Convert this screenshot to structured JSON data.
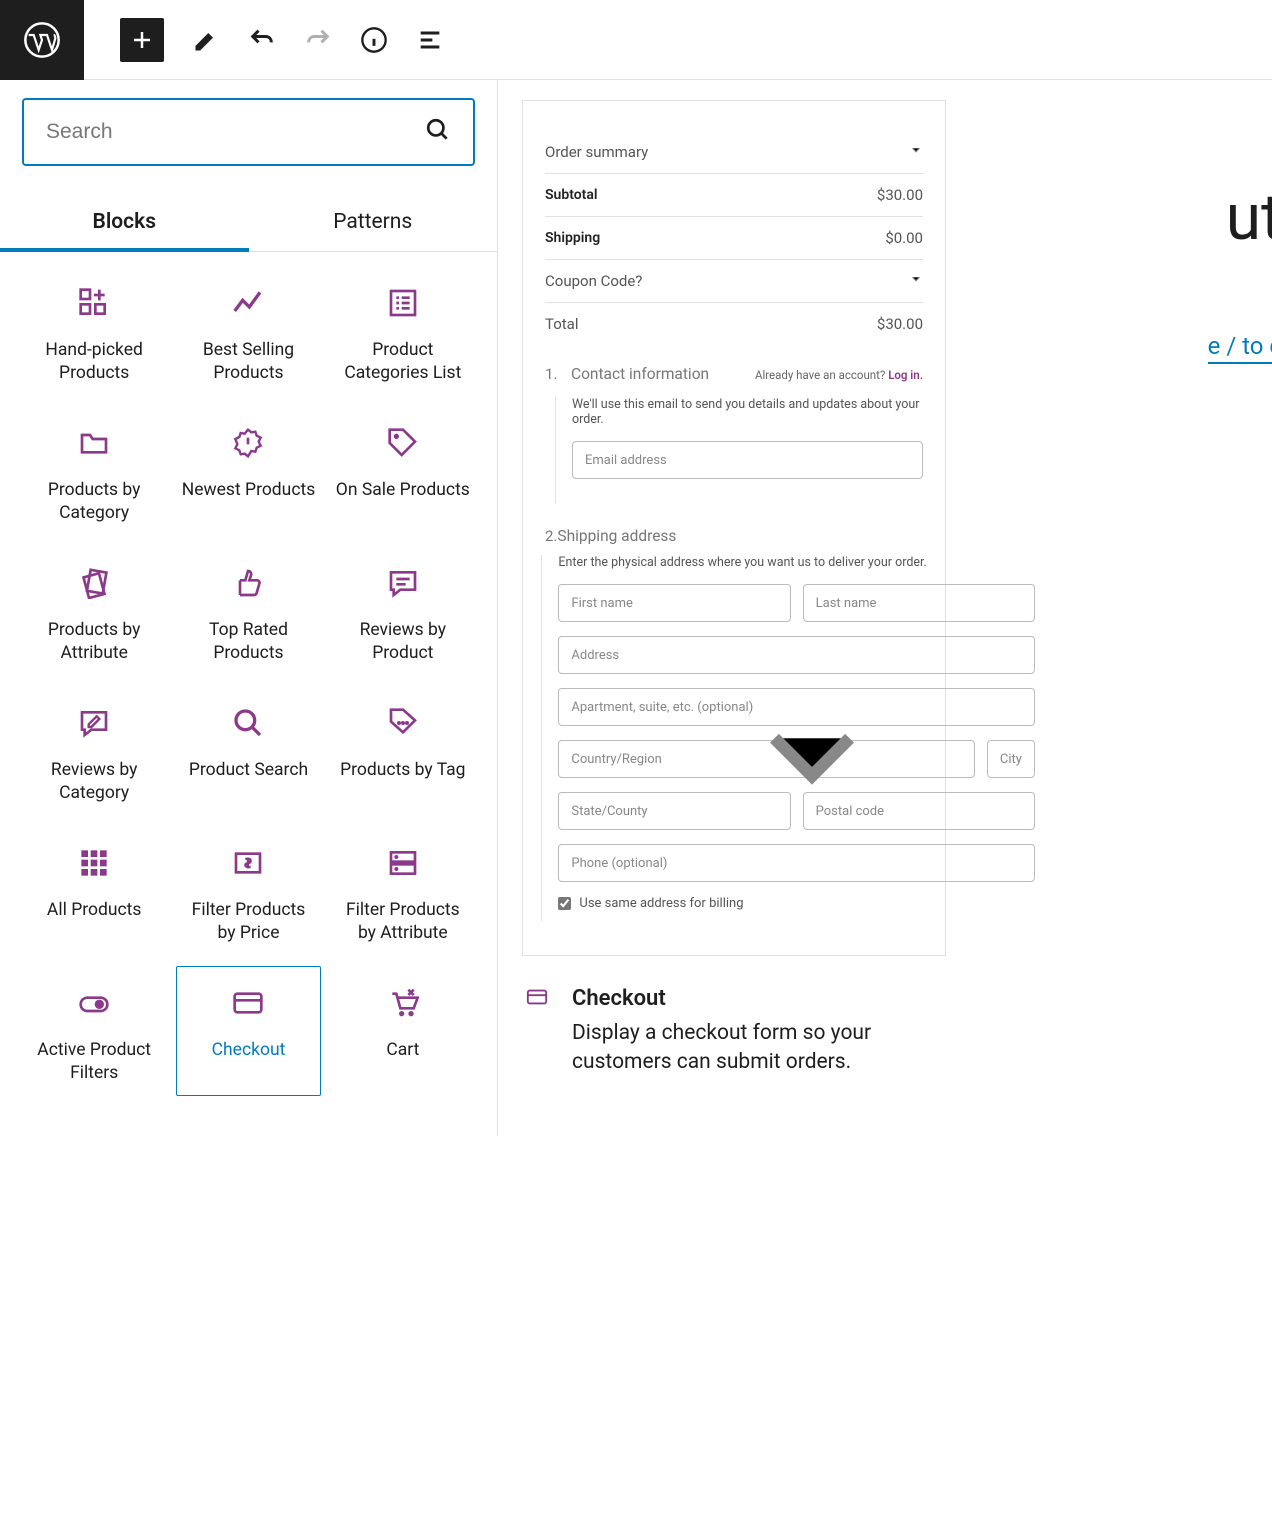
{
  "search": {
    "placeholder": "Search"
  },
  "tabs": {
    "blocks": "Blocks",
    "patterns": "Patterns"
  },
  "blocks": [
    {
      "id": "handpicked",
      "label": "Hand-picked Products",
      "icon": "grid-plus"
    },
    {
      "id": "bestselling",
      "label": "Best Selling Products",
      "icon": "trend"
    },
    {
      "id": "catlist",
      "label": "Product Categories List",
      "icon": "list-box"
    },
    {
      "id": "bycategory",
      "label": "Products by Category",
      "icon": "folder"
    },
    {
      "id": "newest",
      "label": "Newest Products",
      "icon": "badge-new"
    },
    {
      "id": "onsale",
      "label": "On Sale Products",
      "icon": "tag"
    },
    {
      "id": "byattribute",
      "label": "Products by Attribute",
      "icon": "cards"
    },
    {
      "id": "toprated",
      "label": "Top Rated Products",
      "icon": "thumbs"
    },
    {
      "id": "revproduct",
      "label": "Reviews by Product",
      "icon": "review-lines"
    },
    {
      "id": "revcategory",
      "label": "Reviews by Category",
      "icon": "review-edit"
    },
    {
      "id": "search",
      "label": "Product Search",
      "icon": "search"
    },
    {
      "id": "bytag",
      "label": "Products by Tag",
      "icon": "tag-dots"
    },
    {
      "id": "allproducts",
      "label": "All Products",
      "icon": "grid9"
    },
    {
      "id": "filterprice",
      "label": "Filter Products by Price",
      "icon": "price"
    },
    {
      "id": "filterattr",
      "label": "Filter Products by Attribute",
      "icon": "server"
    },
    {
      "id": "activefilters",
      "label": "Active Product Filters",
      "icon": "toggle"
    },
    {
      "id": "checkout",
      "label": "Checkout",
      "icon": "card",
      "selected": true
    },
    {
      "id": "cart",
      "label": "Cart",
      "icon": "cart"
    }
  ],
  "preview": {
    "orderSummary": "Order summary",
    "subtotalLabel": "Subtotal",
    "subtotalValue": "$30.00",
    "shippingLabel": "Shipping",
    "shippingValue": "$0.00",
    "couponLabel": "Coupon Code?",
    "totalLabel": "Total",
    "totalValue": "$30.00",
    "step1Num": "1.",
    "step1Title": "Contact information",
    "loginText": "Already have an account? ",
    "loginLink": "Log in.",
    "step1Desc": "We'll use this email to send you details and updates about your order.",
    "emailPh": "Email address",
    "step2Num": "2.",
    "step2Title": "Shipping address",
    "step2Desc": "Enter the physical address where you want us to deliver your order.",
    "firstNamePh": "First name",
    "lastNamePh": "Last name",
    "addressPh": "Address",
    "aptPh": "Apartment, suite, etc. (optional)",
    "countryPh": "Country/Region",
    "cityPh": "City",
    "statePh": "State/County",
    "postalPh": "Postal code",
    "phonePh": "Phone (optional)",
    "sameAddress": "Use same address for billing"
  },
  "info": {
    "title": "Checkout",
    "desc": "Display a checkout form so your customers can submit orders."
  },
  "bg": {
    "t1": "ut",
    "t2": "e / to c"
  }
}
